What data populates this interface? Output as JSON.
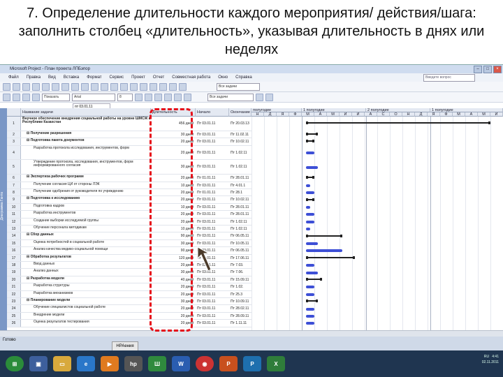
{
  "slide": {
    "title_line1": "7. Определение длительности каждого мероприятия/ действия/шага:",
    "title_line2": "заполнить столбец «длительность», указывая длительность в днях или",
    "title_line3": "неделях"
  },
  "window": {
    "title": "Microsoft Project - План проекта ЛПБэпор",
    "menu": [
      "Файл",
      "Правка",
      "Вид",
      "Вставка",
      "Формат",
      "Сервис",
      "Проект",
      "Отчет",
      "Совместная работа",
      "Окно",
      "Справка"
    ],
    "help_placeholder": "Введите вопрос",
    "font_name": "Arial",
    "task_filter": "Все задачи",
    "show_label": "Показать",
    "entry_value": "пт 03.01.11",
    "view_label": "Диаграмма Ганта"
  },
  "columns": {
    "name": "Название задачи",
    "duration": "Длительность",
    "start": "Начало",
    "finish": "Окончание",
    "periods": [
      "полугодие",
      "1 полугодие",
      "2 полугодие",
      "1 полугодие"
    ],
    "months": [
      "Н",
      "Д",
      "Я",
      "Ф",
      "М",
      "А",
      "М",
      "И",
      "И",
      "А",
      "С",
      "О",
      "Н",
      "Д",
      "Я",
      "Ф",
      "М",
      "А",
      "М",
      "И"
    ]
  },
  "rows": [
    {
      "id": "1",
      "name": "Внучное обеспечение внедрения социальной работы на уровне ШМСЖ в Республике Казахстан",
      "dur": "456 дней",
      "start": "Пт 03.01.11",
      "fin": "Пт 20.03.13",
      "bold": true,
      "h": 2
    },
    {
      "id": "2",
      "name": "Получение разрешения",
      "dur": "30 дней",
      "start": "Пт 03.01.11",
      "fin": "Пт 11.02.11",
      "bold": true,
      "h": 1
    },
    {
      "id": "3",
      "name": "Подготовка пакета документов",
      "dur": "20 дней",
      "start": "Пт 03.01.11",
      "fin": "Пт 10.02.11",
      "bold": true,
      "h": 1
    },
    {
      "id": "4",
      "name": "Разработка протокола исследования, инструментов, форм",
      "dur": "20 дней",
      "start": "Пт 03.01.11",
      "fin": "Пт 1.02.11",
      "bold": false,
      "h": 2
    },
    {
      "id": "5",
      "name": "Утверждение протокола, исследования, инструментов, форм информированного согласия",
      "dur": "30 дней",
      "start": "Пт 03.01.11",
      "fin": "Пт 1.02.11",
      "bold": false,
      "h": 2
    },
    {
      "id": "6",
      "name": "Экспертиза рабочих программ",
      "dur": "20 дней",
      "start": "Пт 01.01.11",
      "fin": "Пт 28.01.11",
      "bold": true,
      "h": 1
    },
    {
      "id": "7",
      "name": "Получение согласия ЦИ от стороны ЛЭК",
      "dur": "10 дней",
      "start": "Пт 03.01.11",
      "fin": "Пт 4.01.1",
      "bold": false,
      "h": 1
    },
    {
      "id": "8",
      "name": "Получение одобрения от руководителя по учреждению",
      "dur": "20 дней",
      "start": "Пт 01.01.11",
      "fin": "Пт 28.1",
      "bold": false,
      "h": 1
    },
    {
      "id": "9",
      "name": "Подготовка к исследованию",
      "dur": "20 дней",
      "start": "Пт 03.01.11",
      "fin": "Пт 10.02.11",
      "bold": true,
      "h": 1
    },
    {
      "id": "10",
      "name": "Подготовка кадров",
      "dur": "10 дней",
      "start": "Пт 03.01.11",
      "fin": "Пт 28.01.11",
      "bold": false,
      "h": 1
    },
    {
      "id": "11",
      "name": "Разработка инструментов",
      "dur": "20 дней",
      "start": "Пт 03.01.11",
      "fin": "Пт 28.01.11",
      "bold": false,
      "h": 1
    },
    {
      "id": "12",
      "name": "Создание выборки исследуемой группы",
      "dur": "20 дней",
      "start": "Пт 03.01.11",
      "fin": "Пт 1.02.11",
      "bold": false,
      "h": 1
    },
    {
      "id": "13",
      "name": "Обучение персонала методикам",
      "dur": "10 дней",
      "start": "Пт 03.01.11",
      "fin": "Пт 1.02.11",
      "bold": false,
      "h": 1
    },
    {
      "id": "14",
      "name": "Сбор данных",
      "dur": "90 дней",
      "start": "Пт 03.01.11",
      "fin": "Пт 06.05.11",
      "bold": true,
      "h": 1
    },
    {
      "id": "15",
      "name": "Оценка потребностей в социальной работе",
      "dur": "30 дней",
      "start": "Пт 03.01.11",
      "fin": "Пт 10.05.11",
      "bold": false,
      "h": 1
    },
    {
      "id": "16",
      "name": "Анализ качества медико-социальной помощи",
      "dur": "90 дней",
      "start": "Пт 03.01.11",
      "fin": "Пт 06.05.11",
      "bold": false,
      "h": 1
    },
    {
      "id": "17",
      "name": "Обработка результатов",
      "dur": "120 дней",
      "start": "Пт 03.01.11",
      "fin": "Пт 17.06.11",
      "bold": true,
      "h": 1
    },
    {
      "id": "18",
      "name": "Ввод данных",
      "dur": "20 дней",
      "start": "Пт 03.01.11",
      "fin": "Пт 7.03.",
      "bold": false,
      "h": 1
    },
    {
      "id": "19",
      "name": "Анализ данных",
      "dur": "30 дней",
      "start": "Пт 03.01.11",
      "fin": "Пт 7.06.",
      "bold": false,
      "h": 1
    },
    {
      "id": "20",
      "name": "Разработка модели",
      "dur": "40 дней",
      "start": "Пт 03.01.11",
      "fin": "Пт 15.09.11",
      "bold": true,
      "h": 1
    },
    {
      "id": "21",
      "name": "Разработка структуры",
      "dur": "20 дней",
      "start": "Пт 03.01.11",
      "fin": "Пт 1.02.",
      "bold": false,
      "h": 1
    },
    {
      "id": "22",
      "name": "Разработка механизмов",
      "dur": "20 дней",
      "start": "Пт 03.01.11",
      "fin": "Пт 25.3",
      "bold": false,
      "h": 1
    },
    {
      "id": "23",
      "name": "Планирование модели",
      "dur": "30 дней",
      "start": "Пт 03.01.11",
      "fin": "Пт 10.09.11",
      "bold": true,
      "h": 1
    },
    {
      "id": "24",
      "name": "Обучение специалистов социальной работе",
      "dur": "20 дней",
      "start": "Пт 03.01.11",
      "fin": "Пт 28.02.11",
      "bold": false,
      "h": 1
    },
    {
      "id": "25",
      "name": "Внедрение модели",
      "dur": "20 дней",
      "start": "Пт 03.01.11",
      "fin": "Пт 28.09.11",
      "bold": false,
      "h": 1
    },
    {
      "id": "26",
      "name": "Оценка результатов тестирования",
      "dur": "20 дней",
      "start": "Пт 03.01.11",
      "fin": "Пт 1.11.11",
      "bold": false,
      "h": 1
    }
  ],
  "status": {
    "text": "Готово"
  },
  "taskbar": {
    "popup": "НРАения",
    "clock": "4:41",
    "date": "02.11.2011",
    "lang": "RU"
  }
}
